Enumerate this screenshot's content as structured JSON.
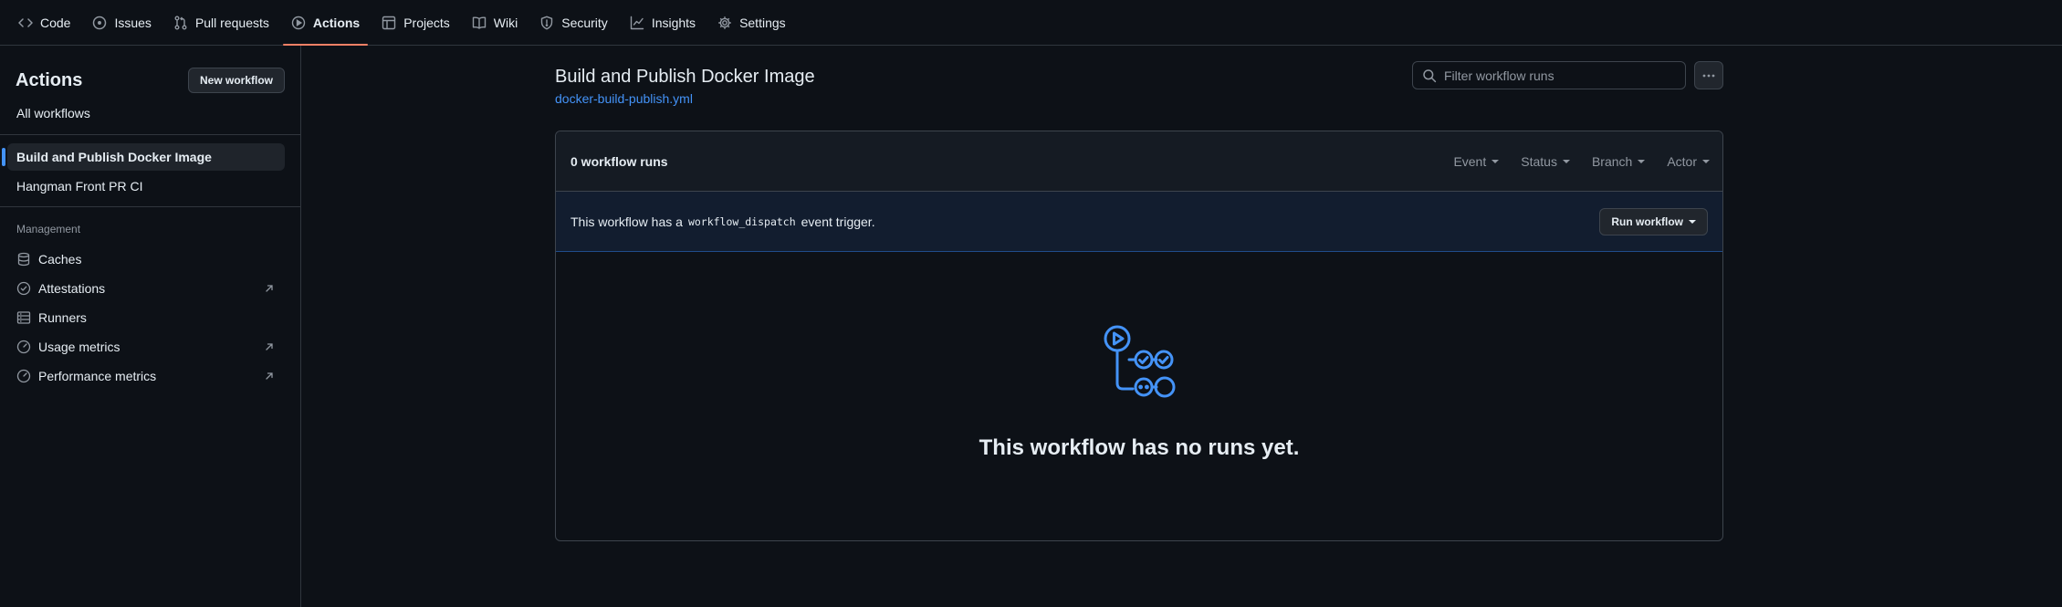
{
  "nav": {
    "tabs": [
      {
        "label": "Code",
        "icon": "code-icon"
      },
      {
        "label": "Issues",
        "icon": "issue-opened-icon"
      },
      {
        "label": "Pull requests",
        "icon": "git-pull-request-icon"
      },
      {
        "label": "Actions",
        "icon": "play-icon",
        "active": true
      },
      {
        "label": "Projects",
        "icon": "table-icon"
      },
      {
        "label": "Wiki",
        "icon": "book-icon"
      },
      {
        "label": "Security",
        "icon": "shield-icon"
      },
      {
        "label": "Insights",
        "icon": "graph-icon"
      },
      {
        "label": "Settings",
        "icon": "gear-icon"
      }
    ]
  },
  "sidebar": {
    "title": "Actions",
    "new_workflow": "New workflow",
    "all_workflows": "All workflows",
    "workflows": [
      {
        "label": "Build and Publish Docker Image",
        "selected": true
      },
      {
        "label": "Hangman Front PR CI"
      }
    ],
    "management_heading": "Management",
    "management": [
      {
        "label": "Caches",
        "icon": "database-icon"
      },
      {
        "label": "Attestations",
        "icon": "verified-icon",
        "external": true
      },
      {
        "label": "Runners",
        "icon": "server-icon"
      },
      {
        "label": "Usage metrics",
        "icon": "meter-icon",
        "external": true
      },
      {
        "label": "Performance metrics",
        "icon": "meter-icon",
        "external": true
      }
    ]
  },
  "main": {
    "title": "Build and Publish Docker Image",
    "file": "docker-build-publish.yml",
    "filter_placeholder": "Filter workflow runs",
    "run_count": "0 workflow runs",
    "filters": [
      "Event",
      "Status",
      "Branch",
      "Actor"
    ],
    "dispatch": {
      "prefix": "This workflow has a",
      "code": "workflow_dispatch",
      "suffix": "event trigger.",
      "button": "Run workflow"
    },
    "empty_text": "This workflow has no runs yet."
  },
  "colors": {
    "background": "#0d1117",
    "accent": "#4493f8",
    "active_tab_underline": "#f78166",
    "border": "#30363d"
  }
}
